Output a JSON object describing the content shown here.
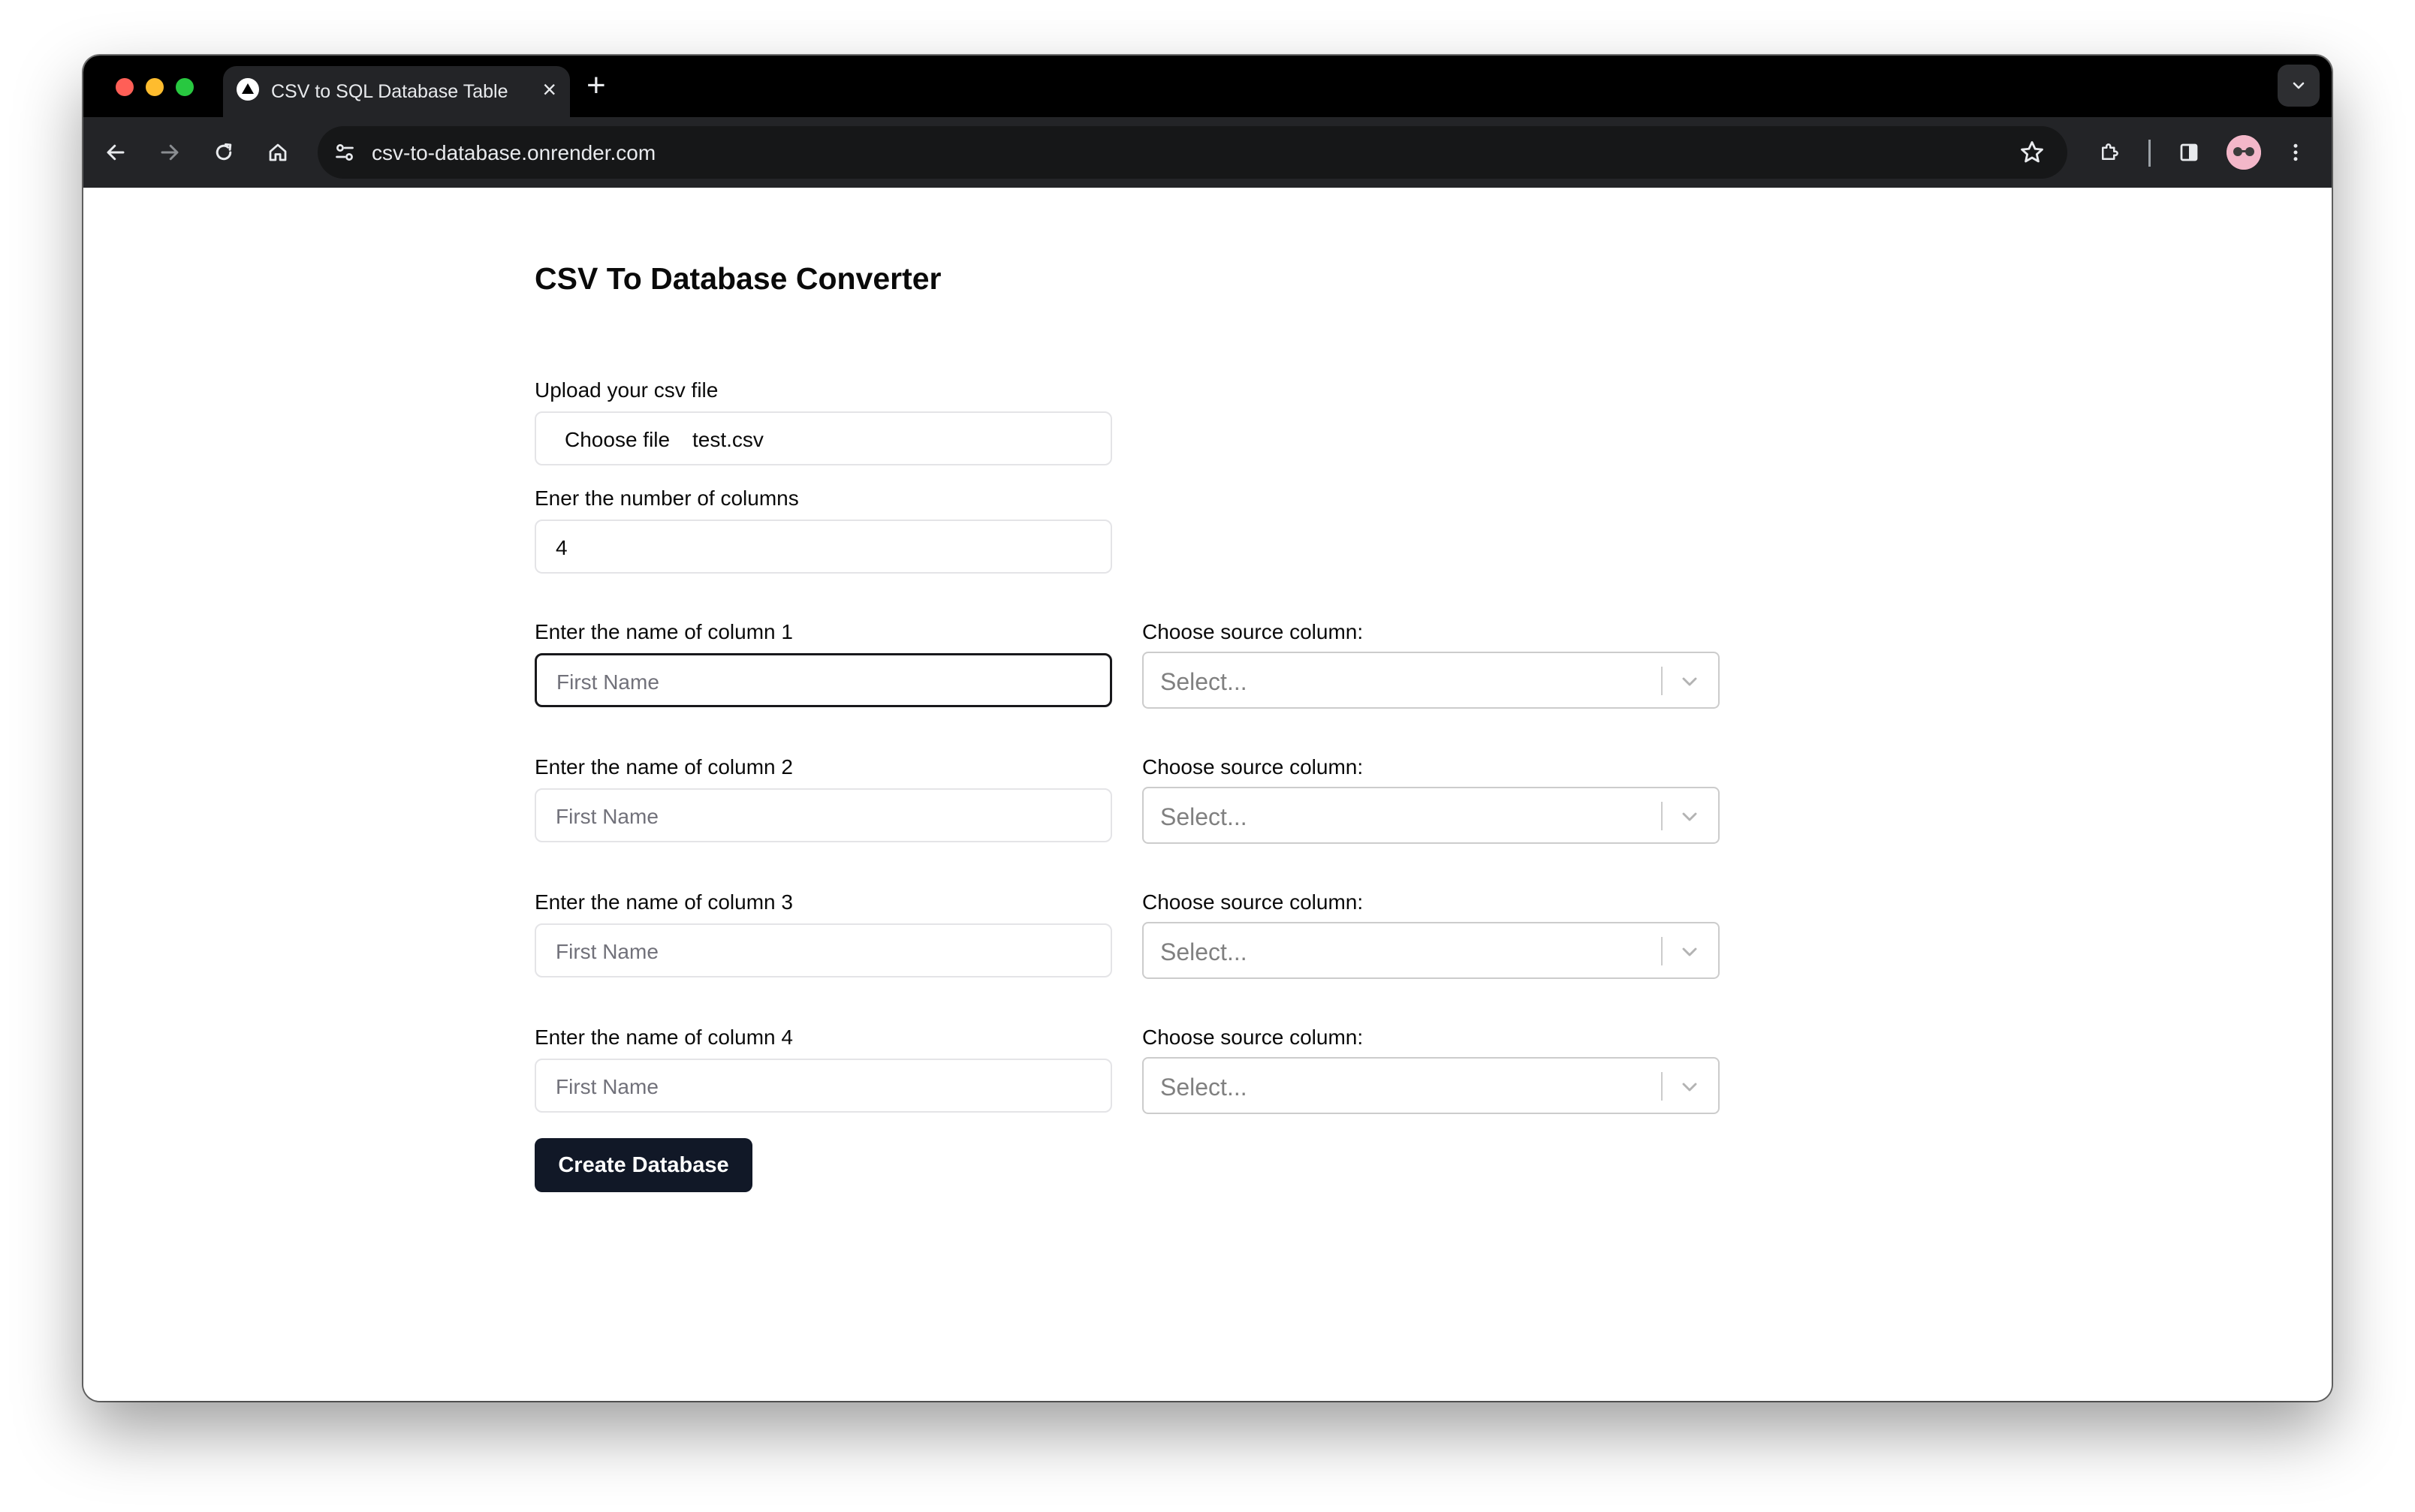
{
  "browser": {
    "tab_title": "CSV to SQL Database Table",
    "tab_close": "×",
    "new_tab": "+",
    "url": "csv-to-database.onrender.com"
  },
  "form": {
    "title": "CSV To Database Converter",
    "upload_label": "Upload your csv file",
    "file_button": "Choose file",
    "file_name": "test.csv",
    "num_columns_label": "Ener the number of columns",
    "num_columns_value": "4",
    "columns": [
      {
        "name_label": "Enter the name of column 1",
        "name_placeholder": "First Name",
        "source_label": "Choose source column:",
        "source_placeholder": "Select..."
      },
      {
        "name_label": "Enter the name of column 2",
        "name_placeholder": "First Name",
        "source_label": "Choose source column:",
        "source_placeholder": "Select..."
      },
      {
        "name_label": "Enter the name of column 3",
        "name_placeholder": "First Name",
        "source_label": "Choose source column:",
        "source_placeholder": "Select..."
      },
      {
        "name_label": "Enter the name of column 4",
        "name_placeholder": "First Name",
        "source_label": "Choose source column:",
        "source_placeholder": "Select..."
      }
    ],
    "submit_label": "Create Database"
  },
  "icons": {
    "back": "arrow-left-icon",
    "forward": "arrow-right-icon",
    "reload": "reload-icon",
    "home": "home-icon",
    "site_info": "tune-icon",
    "bookmark": "star-icon",
    "extensions": "puzzle-icon",
    "side_panel": "side-panel-icon",
    "menu": "kebab-menu-icon"
  },
  "colors": {
    "primary_button": "#111827",
    "tab_strip": "#000000",
    "toolbar": "#232427"
  }
}
